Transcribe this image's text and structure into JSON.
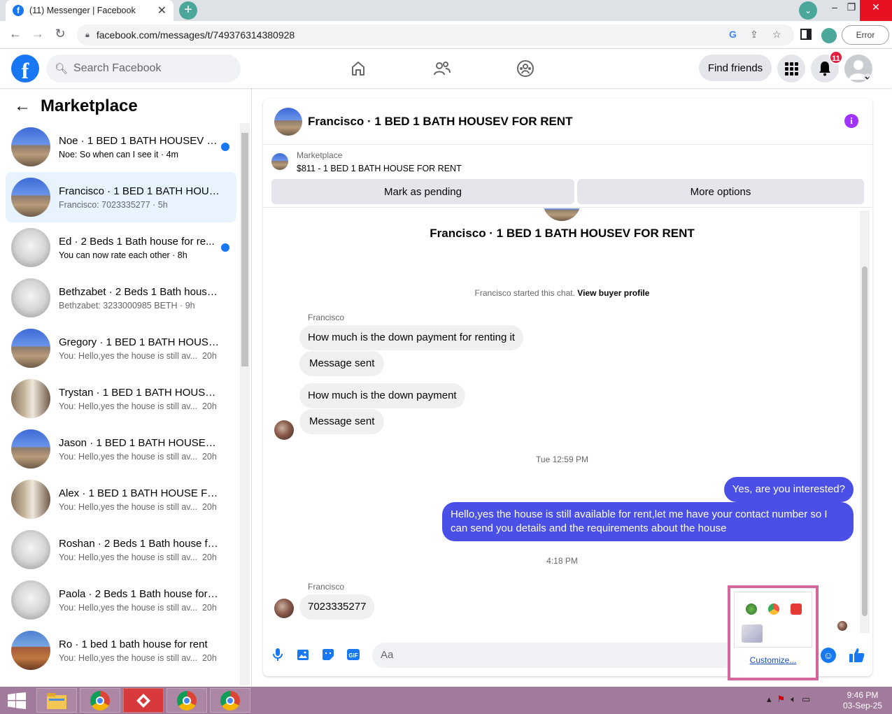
{
  "browser": {
    "tab_title": "(11) Messenger | Facebook",
    "url": "facebook.com/messages/t/749376314380928",
    "error_label": "Error"
  },
  "fb": {
    "search_placeholder": "Search Facebook",
    "find_friends": "Find friends",
    "notif_count": "11"
  },
  "left": {
    "title": "Marketplace",
    "conversations": [
      {
        "name": "Noe · 1 BED 1 BATH HOUSEV F...",
        "preview": "Noe: So when can I see it",
        "time": "4m",
        "unread": true,
        "thumb": "house"
      },
      {
        "name": "Francisco · 1 BED 1 BATH HOUSE...",
        "preview": "Francisco: 7023335277",
        "time": "5h",
        "unread": false,
        "thumb": "house"
      },
      {
        "name": "Ed · 2 Beds 1 Bath house for re...",
        "preview": "You can now rate each other",
        "time": "8h",
        "unread": true,
        "thumb": "room"
      },
      {
        "name": "Bethzabet · 2 Beds 1 Bath house...",
        "preview": "Bethzabet: 3233000985 BETH",
        "time": "9h",
        "unread": false,
        "thumb": "room"
      },
      {
        "name": "Gregory · 1 BED 1 BATH HOUSE...",
        "preview": "You: Hello,yes the house is still av...",
        "time": "20h",
        "unread": false,
        "thumb": "house"
      },
      {
        "name": "Trystan · 1 BED 1 BATH HOUSE F...",
        "preview": "You: Hello,yes the house is still av...",
        "time": "20h",
        "unread": false,
        "thumb": "hall"
      },
      {
        "name": "Jason · 1 BED 1 BATH HOUSEV F...",
        "preview": "You: Hello,yes the house is still av...",
        "time": "20h",
        "unread": false,
        "thumb": "house"
      },
      {
        "name": "Alex · 1 BED 1 BATH HOUSE FOR...",
        "preview": "You: Hello,yes the house is still av...",
        "time": "20h",
        "unread": false,
        "thumb": "hall"
      },
      {
        "name": "Roshan · 2 Beds 1 Bath house fo...",
        "preview": "You: Hello,yes the house is still av...",
        "time": "20h",
        "unread": false,
        "thumb": "room"
      },
      {
        "name": "Paola · 2 Beds 1 Bath house for r...",
        "preview": "You: Hello,yes the house is still av...",
        "time": "20h",
        "unread": false,
        "thumb": "room"
      },
      {
        "name": "Ro · 1 bed 1 bath house for rent",
        "preview": "You: Hello,yes the house is still av...",
        "time": "20h",
        "unread": false,
        "thumb": "yard"
      }
    ]
  },
  "chat": {
    "header_name": "Francisco · 1 BED 1 BATH HOUSEV FOR RENT",
    "marketplace_label": "Marketplace",
    "listing": "$811 - 1 BED 1 BATH HOUSE FOR RENT",
    "mark_pending": "Mark as pending",
    "more_options": "More options",
    "top_title": "Francisco · 1 BED 1 BATH HOUSEV FOR RENT",
    "started_text": "Francisco started this chat.",
    "view_profile": "View buyer profile",
    "sender1": "Francisco",
    "msg1": "How much is the down payment for renting it",
    "msg2": "Message sent",
    "msg3": "How much is the down payment",
    "msg4": "Message sent",
    "time1": "Tue 12:59 PM",
    "out1": "Yes, are you interested?",
    "out2": "Hello,yes the house is still available for rent,let me have your contact number so I can send you details and the requirements about the house",
    "time2": "4:18 PM",
    "sender2": "Francisco",
    "msg5": "7023335277",
    "composer_placeholder": "Aa"
  },
  "popup": {
    "customize": "Customize..."
  },
  "taskbar": {
    "time": "9:46 PM",
    "date": "03-Sep-25"
  },
  "colors": {
    "fb_blue": "#1877f2",
    "outgoing_bubble": "#4a4fe6",
    "taskbar": "#a27a9b",
    "popup_border": "#d4669e"
  }
}
